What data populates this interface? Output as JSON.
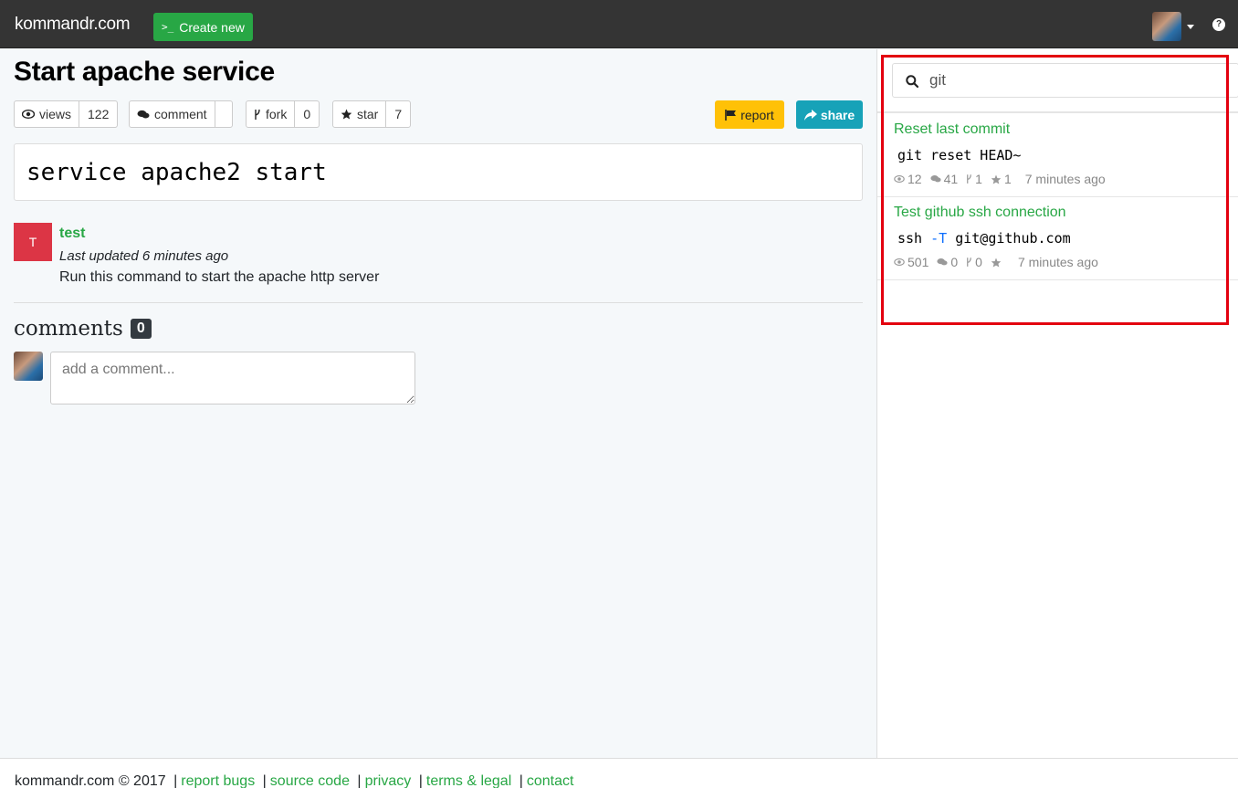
{
  "navbar": {
    "brand": "kommandr.com",
    "create_label": "Create new",
    "create_prompt": ">_"
  },
  "command": {
    "title": "Start apache service",
    "stats": {
      "views_label": "views",
      "views": "122",
      "comment_label": "comment",
      "comments": "",
      "fork_label": "fork",
      "forks": "0",
      "star_label": "star",
      "stars": "7"
    },
    "report_label": "report",
    "share_label": "share",
    "code": "service apache2 start",
    "author_initial": "T",
    "author": "test",
    "updated": "Last updated 6 minutes ago",
    "description": "Run this command to start the apache http server"
  },
  "comments": {
    "title": "comments",
    "count": "0",
    "placeholder": "add a comment..."
  },
  "search": {
    "query": "git",
    "results": [
      {
        "title": "Reset last commit",
        "cmd_parts": [
          "git reset HEAD~",
          "",
          ""
        ],
        "views": "12",
        "comments": "41",
        "forks": "1",
        "stars": "1",
        "time": "7 minutes ago"
      },
      {
        "title": "Test github ssh connection",
        "cmd_parts": [
          "ssh ",
          "-T",
          " git@github.com"
        ],
        "views": "501",
        "comments": "0",
        "forks": "0",
        "stars": "",
        "time": "7 minutes ago"
      }
    ]
  },
  "footer": {
    "copyright": "kommandr.com © 2017",
    "links": [
      "report bugs",
      "source code",
      "privacy",
      "terms & legal",
      "contact"
    ]
  },
  "colors": {
    "navbar": "#343434",
    "accent_green": "#28a745",
    "report_yellow": "#ffc107",
    "share_teal": "#17a2b8",
    "author_red": "#dc3545",
    "highlight_red": "#e3000f"
  }
}
